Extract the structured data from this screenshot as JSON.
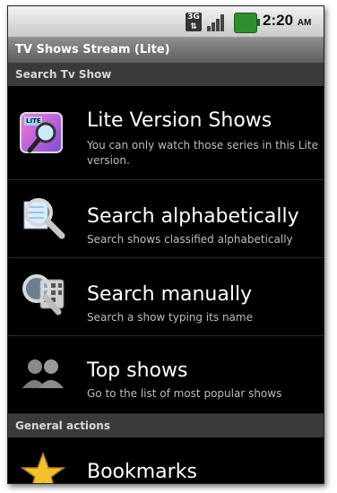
{
  "status_bar": {
    "network": "3G",
    "time": "2:20",
    "ampm": "AM"
  },
  "title_bar": {
    "title": "TV Shows Stream (Lite)"
  },
  "sections": [
    {
      "label": "Search Tv Show"
    },
    {
      "label": "General actions"
    }
  ],
  "search_items": [
    {
      "icon": "lite-search-icon",
      "title": "Lite Version Shows",
      "subtitle": "You can only watch those series in this Lite version.",
      "icon_badge": "LITE"
    },
    {
      "icon": "magnifier-list-icon",
      "title": "Search alphabetically",
      "subtitle": "Search shows classified alphabetically"
    },
    {
      "icon": "keyboard-search-icon",
      "title": "Search manually",
      "subtitle": "Search a show typing its name"
    },
    {
      "icon": "people-icon",
      "title": "Top shows",
      "subtitle": "Go to the list of most popular shows"
    }
  ],
  "general_items": [
    {
      "icon": "star-icon",
      "title": "Bookmarks"
    }
  ],
  "colors": {
    "background": "#000000",
    "section": "#3a3a3a",
    "titlebar": "#6e6e6e",
    "subtitle": "#bdbdbd"
  }
}
